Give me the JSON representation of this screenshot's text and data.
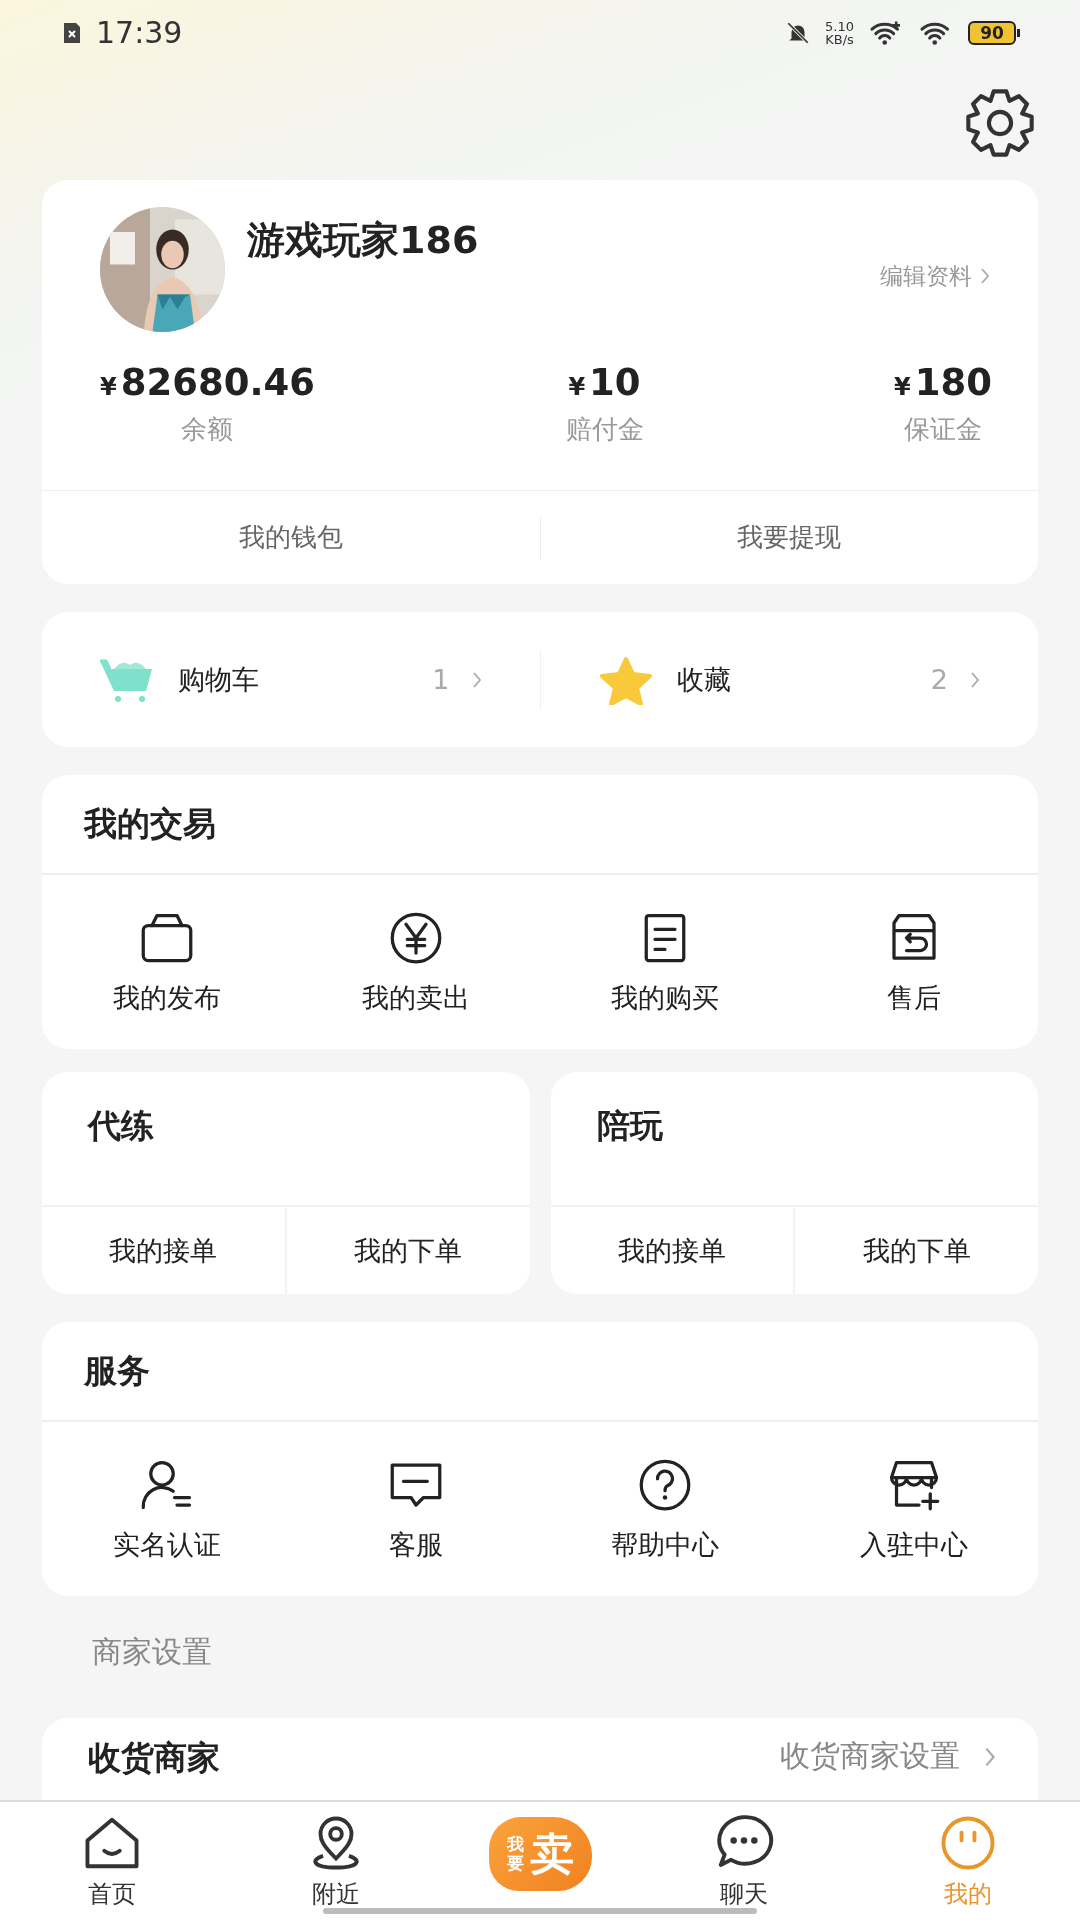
{
  "status_bar": {
    "time": "17:39",
    "net_speed": "5.10",
    "net_unit": "KB/s",
    "battery": "90"
  },
  "profile": {
    "name": "游戏玩家186",
    "edit_link": "编辑资料",
    "balances": [
      {
        "currency": "¥",
        "amount": "82680.46",
        "label": "余额"
      },
      {
        "currency": "¥",
        "amount": "10",
        "label": "赔付金"
      },
      {
        "currency": "¥",
        "amount": "180",
        "label": "保证金"
      }
    ],
    "actions": [
      "我的钱包",
      "我要提现"
    ]
  },
  "shortcuts": [
    {
      "kind": "cart",
      "label": "购物车",
      "count": "1"
    },
    {
      "kind": "star",
      "label": "收藏",
      "count": "2"
    }
  ],
  "trade": {
    "title": "我的交易",
    "items": [
      {
        "kind": "bag",
        "label": "我的发布"
      },
      {
        "kind": "yen",
        "label": "我的卖出"
      },
      {
        "kind": "list",
        "label": "我的购买"
      },
      {
        "kind": "return",
        "label": "售后"
      }
    ]
  },
  "order_cards": [
    {
      "title": "代练",
      "actions": [
        "我的接单",
        "我的下单"
      ]
    },
    {
      "title": "陪玩",
      "actions": [
        "我的接单",
        "我的下单"
      ]
    }
  ],
  "services": {
    "title": "服务",
    "items": [
      {
        "kind": "person",
        "label": "实名认证"
      },
      {
        "kind": "chat",
        "label": "客服"
      },
      {
        "kind": "help",
        "label": "帮助中心"
      },
      {
        "kind": "store",
        "label": "入驻中心"
      }
    ]
  },
  "merchant": {
    "heading": "商家设置",
    "row_title": "收货商家",
    "row_link": "收货商家设置"
  },
  "bottom_nav": [
    {
      "kind": "home",
      "label": "首页",
      "selected": false
    },
    {
      "kind": "pin",
      "label": "附近",
      "selected": false
    },
    {
      "kind": "sell",
      "prefix": "我要",
      "label": "卖",
      "selected": false
    },
    {
      "kind": "chat",
      "label": "聊天",
      "selected": false
    },
    {
      "kind": "face",
      "label": "我的",
      "selected": true
    }
  ]
}
